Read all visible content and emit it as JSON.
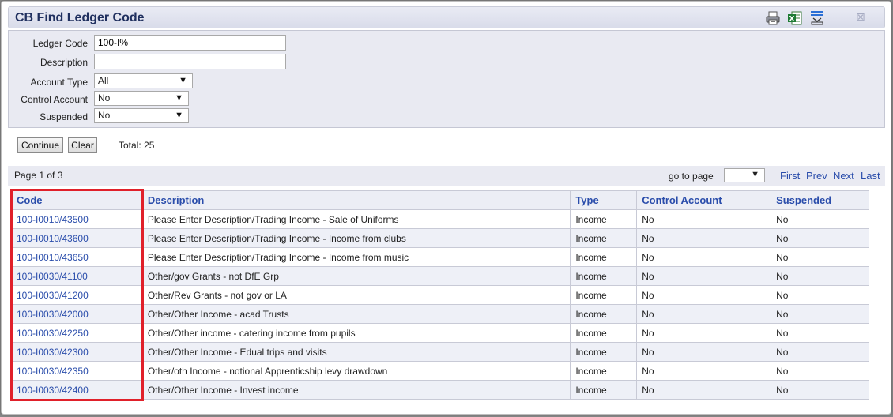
{
  "window": {
    "title": "CB Find Ledger Code"
  },
  "toolbar": {
    "print_icon": "printer-icon",
    "excel_icon": "excel-icon",
    "export_icon": "export-icon",
    "close_icon": "close-icon",
    "close_glyph": "⊠"
  },
  "filters": {
    "ledger_code": {
      "label": "Ledger Code",
      "value": "100-I%"
    },
    "description": {
      "label": "Description",
      "value": ""
    },
    "account_type": {
      "label": "Account Type",
      "value": "All"
    },
    "control_account": {
      "label": "Control Account",
      "value": "No"
    },
    "suspended": {
      "label": "Suspended",
      "value": "No"
    }
  },
  "actions": {
    "continue_label": "Continue",
    "clear_label": "Clear",
    "total_text": "Total: 25"
  },
  "pager": {
    "page_text": "Page 1 of 3",
    "goto_label": "go to page",
    "goto_value": "",
    "first": "First",
    "prev": "Prev",
    "next": "Next",
    "last": "Last"
  },
  "table": {
    "columns": [
      "Code",
      "Description",
      "Type",
      "Control Account",
      "Suspended"
    ],
    "rows": [
      [
        "100-I0010/43500",
        "Please Enter Description/Trading Income - Sale of Uniforms",
        "Income",
        "No",
        "No"
      ],
      [
        "100-I0010/43600",
        "Please Enter Description/Trading Income - Income from clubs",
        "Income",
        "No",
        "No"
      ],
      [
        "100-I0010/43650",
        "Please Enter Description/Trading Income - Income from music",
        "Income",
        "No",
        "No"
      ],
      [
        "100-I0030/41100",
        "Other/gov Grants - not DfE Grp",
        "Income",
        "No",
        "No"
      ],
      [
        "100-I0030/41200",
        "Other/Rev Grants - not gov or LA",
        "Income",
        "No",
        "No"
      ],
      [
        "100-I0030/42000",
        "Other/Other Income - acad Trusts",
        "Income",
        "No",
        "No"
      ],
      [
        "100-I0030/42250",
        "Other/Other income - catering income from pupils",
        "Income",
        "No",
        "No"
      ],
      [
        "100-I0030/42300",
        "Other/Other Income - Edual trips and visits",
        "Income",
        "No",
        "No"
      ],
      [
        "100-I0030/42350",
        "Other/oth Income - notional Apprenticship levy drawdown",
        "Income",
        "No",
        "No"
      ],
      [
        "100-I0030/42400",
        "Other/Other Income - Invest income",
        "Income",
        "No",
        "No"
      ]
    ]
  },
  "colors": {
    "link": "#2a4dab",
    "title": "#20305f",
    "highlight": "#e0202a"
  }
}
